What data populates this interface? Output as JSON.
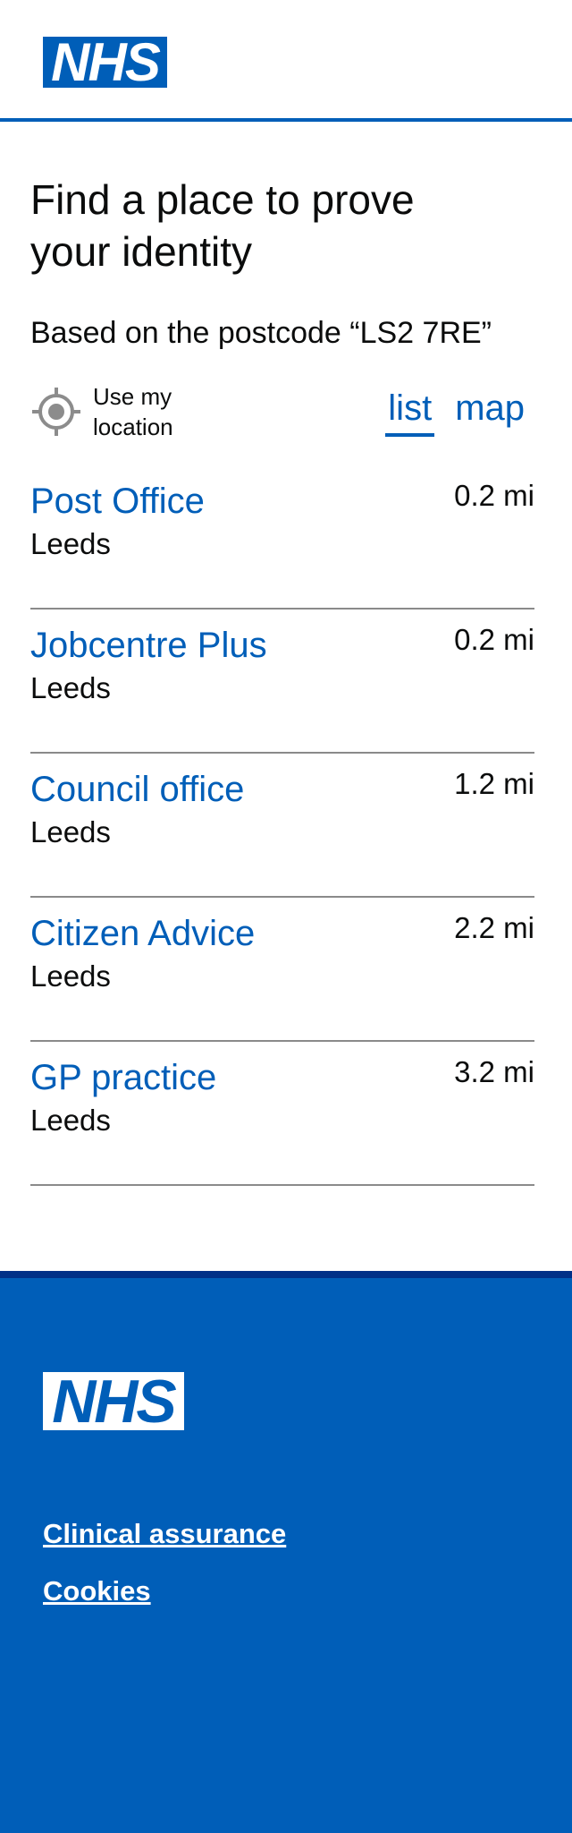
{
  "header": {
    "logo": "NHS"
  },
  "page": {
    "title": "Find a place to prove your identity",
    "subtitle": "Based on the postcode “LS2 7RE”"
  },
  "location": {
    "label": "Use my location",
    "icon": "crosshair-icon"
  },
  "view_tabs": [
    {
      "label": "list",
      "active": true
    },
    {
      "label": "map",
      "active": false
    }
  ],
  "results": [
    {
      "name": "Post Office",
      "city": "Leeds",
      "distance": "0.2 mi"
    },
    {
      "name": "Jobcentre Plus",
      "city": "Leeds",
      "distance": "0.2 mi"
    },
    {
      "name": "Council office",
      "city": "Leeds",
      "distance": "1.2 mi"
    },
    {
      "name": "Citizen Advice",
      "city": "Leeds",
      "distance": "2.2 mi"
    },
    {
      "name": "GP practice",
      "city": "Leeds",
      "distance": "3.2 mi"
    }
  ],
  "footer": {
    "logo": "NHS",
    "links": [
      "Clinical assurance",
      "Cookies"
    ]
  },
  "colors": {
    "nhs_blue": "#005eb8",
    "nhs_dark_blue": "#003087",
    "text": "#0b0c0c"
  }
}
